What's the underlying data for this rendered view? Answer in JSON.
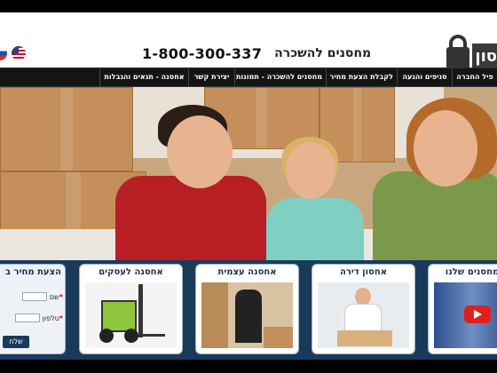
{
  "header": {
    "phone": "1-800-300-337",
    "tagline": "מחסנים להשכרה",
    "logo_text": "סון כל"
  },
  "flags": [
    "flag-ru-icon",
    "flag-us-icon"
  ],
  "nav": {
    "items": [
      {
        "label": "אחסנה - תנאים והגבלות"
      },
      {
        "label": "יצירת קשר"
      },
      {
        "label": "מחסנים להשכרה - תמונות"
      },
      {
        "label": "לקבלת הצעת מחיר"
      },
      {
        "label": "סניפים והגעה"
      },
      {
        "label": "פיל החברה"
      }
    ]
  },
  "cards": {
    "quote": {
      "title": "הצעת מחיר ב",
      "name_label": "שם",
      "phone_label": "טלפון",
      "submit": "שלח"
    },
    "business": {
      "title": "אחסנה לעסקים"
    },
    "self": {
      "title": "אחסנה עצמית"
    },
    "apartment": {
      "title": "אחסון דירה"
    },
    "ours": {
      "title": "מחסנים שלנו"
    }
  },
  "colors": {
    "nav_bg": "#141414",
    "cards_bg": "#1a3a5c",
    "card_title": "#1a2f4d"
  }
}
